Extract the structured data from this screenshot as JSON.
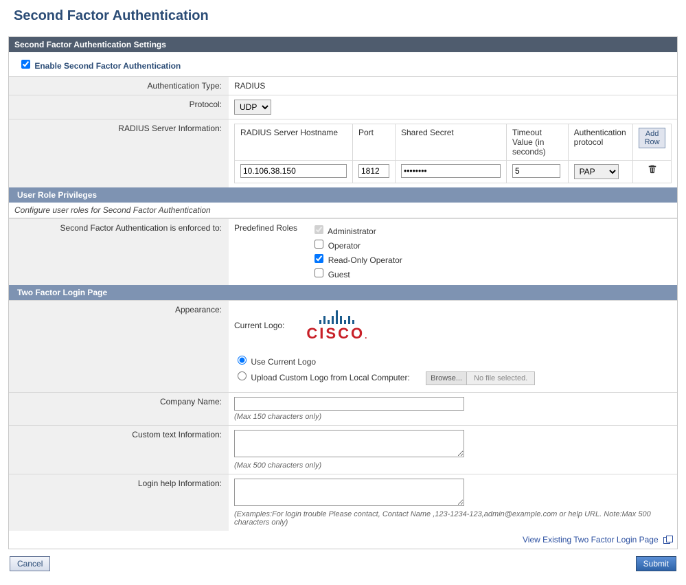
{
  "page_title": "Second Factor Authentication",
  "section1": {
    "header": "Second Factor Authentication Settings",
    "enable_label": "Enable Second Factor Authentication",
    "enable_checked": true,
    "auth_type_label": "Authentication Type:",
    "auth_type_value": "RADIUS",
    "protocol_label": "Protocol:",
    "protocol_value": "UDP",
    "radius_info_label": "RADIUS Server Information:",
    "radius_headers": {
      "hostname": "RADIUS Server Hostname",
      "port": "Port",
      "secret": "Shared Secret",
      "timeout": "Timeout Value (in seconds)",
      "authproto": "Authentication protocol",
      "addrow": "Add Row"
    },
    "radius_row": {
      "hostname": "10.106.38.150",
      "port": "1812",
      "secret": "••••••••",
      "timeout": "5",
      "authproto": "PAP"
    }
  },
  "section2": {
    "header": "User Role Privileges",
    "note": "Configure user roles for Second Factor Authentication",
    "enforced_label": "Second Factor Authentication is enforced to:",
    "predefined_label": "Predefined Roles",
    "roles": {
      "administrator": {
        "label": "Administrator",
        "checked": true,
        "disabled": true
      },
      "operator": {
        "label": "Operator",
        "checked": false
      },
      "readonly": {
        "label": "Read-Only Operator",
        "checked": true
      },
      "guest": {
        "label": "Guest",
        "checked": false
      }
    }
  },
  "section3": {
    "header": "Two Factor Login Page",
    "appearance_label": "Appearance:",
    "current_logo_label": "Current Logo:",
    "logo_text": "CISCO",
    "use_current_label": "Use Current Logo",
    "upload_label": "Upload Custom Logo from Local Computer:",
    "browse_label": "Browse...",
    "no_file_label": "No file selected.",
    "company_name_label": "Company Name:",
    "company_name_value": "",
    "company_name_hint": "(Max 150 characters only)",
    "custom_text_label": "Custom text Information:",
    "custom_text_value": "",
    "custom_text_hint": "(Max 500 characters only)",
    "login_help_label": "Login help Information:",
    "login_help_value": "",
    "login_help_hint": "(Examples:For login trouble Please contact, Contact Name ,123-1234-123,admin@example.com or help URL. Note:Max 500 characters only)"
  },
  "footer_link": "View Existing Two Factor Login Page",
  "buttons": {
    "cancel": "Cancel",
    "submit": "Submit"
  }
}
